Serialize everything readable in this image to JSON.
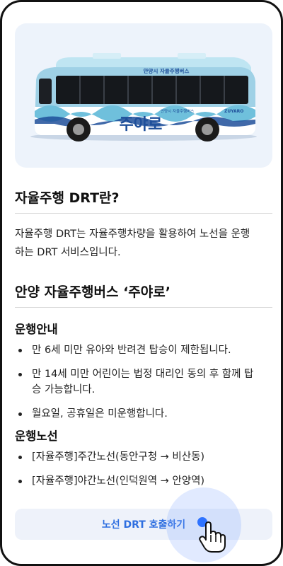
{
  "hero": {
    "bus_top_label": "안양시 자율주행버스",
    "bus_brand": "주야로",
    "bus_side_small": "안양시 자율주행버스",
    "bus_logo_text": "ZUYARO",
    "colors": {
      "bus_body": "#9fd1e6",
      "bus_roof": "#bfe5f2",
      "accent": "#1e4f9a",
      "wave": "#6fc0dc"
    }
  },
  "section1": {
    "title": "자율주행 DRT란?",
    "line1": "자율주행 DRT는 자율주행차량을 활용하여 노선을 운행",
    "line2": "하는 DRT 서비스입니다."
  },
  "section2": {
    "title": "안양 자율주행버스 ‘주야로’",
    "guide_title": "운행안내",
    "guide_items": [
      {
        "line1": "만 6세 미만 유아와 반려견 탑승이 제한됩니다."
      },
      {
        "line1": "만 14세 미만 어린이는 법정 대리인 동의 후 함께 탑",
        "line2": "승 가능합니다."
      },
      {
        "line1": "월요일, 공휴일은 미운행합니다."
      }
    ],
    "route_title": "운행노선",
    "route_items": [
      {
        "line1": "[자율주행]주간노선(동안구청 → 비산동)"
      },
      {
        "line1": "[자율주행]야간노선(인덕원역 → 안양역)"
      }
    ]
  },
  "cta": {
    "label": "노선 DRT 호출하기",
    "accent": "#2e6fe0"
  }
}
